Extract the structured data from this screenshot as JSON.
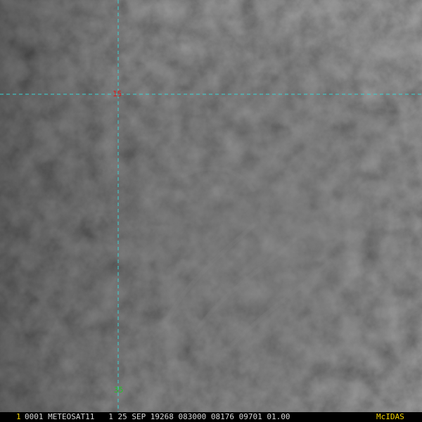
{
  "imagery": {
    "description_color_dark": "#2e2e2e",
    "description_color_light": "#6a6a6a"
  },
  "overlay": {
    "grid_color": "#39d5d5",
    "lat_label": "15",
    "lat_label_color": "#e01818",
    "lon_label": "35",
    "lon_label_color": "#22c322"
  },
  "status_bar": {
    "frame_number": "1",
    "frame_number_color": "#f0d000",
    "info_text": "0001 METEOSAT11   1 25 SEP 19268 083000 08176 09701 01.00",
    "brand": "McIDAS",
    "brand_color": "#f0d000"
  }
}
